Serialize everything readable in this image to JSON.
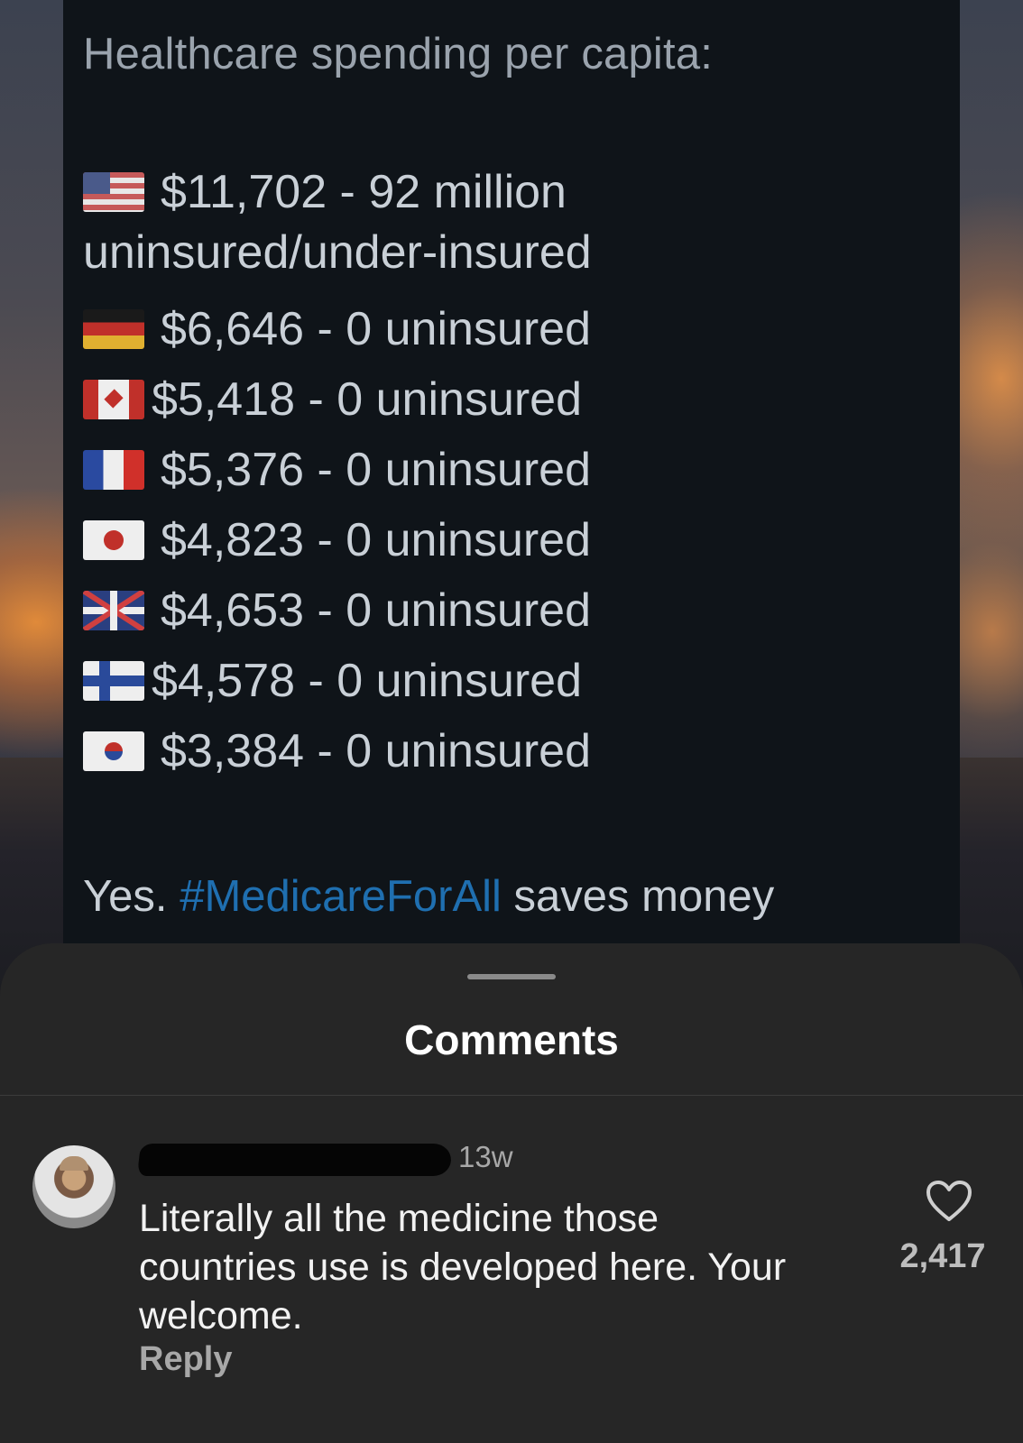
{
  "tweet": {
    "title": "Healthcare spending per capita:",
    "rows": [
      {
        "flag": "us-flag-icon",
        "text": "$11,702 - 92 million",
        "continuation": "uninsured/under-insured"
      },
      {
        "flag": "germany-flag-icon",
        "text": "$6,646 - 0 uninsured"
      },
      {
        "flag": "canada-flag-icon",
        "text": "$5,418 - 0 uninsured"
      },
      {
        "flag": "france-flag-icon",
        "text": "$5,376 - 0 uninsured"
      },
      {
        "flag": "japan-flag-icon",
        "text": "$4,823 - 0 uninsured"
      },
      {
        "flag": "uk-flag-icon",
        "text": "$4,653 - 0 uninsured"
      },
      {
        "flag": "finland-flag-icon",
        "text": "$4,578 - 0 uninsured"
      },
      {
        "flag": "south-korea-flag-icon",
        "text": "$3,384 - 0 uninsured"
      }
    ],
    "footer_prefix": "Yes.",
    "hashtag": "#MedicareForAll",
    "footer_suffix": "saves money",
    "hashtag_color": "#1f6fb0"
  },
  "comments": {
    "title": "Comments",
    "items": [
      {
        "timestamp": "13w",
        "text": "Literally all the medicine those countries use is developed here. Your welcome.",
        "reply_label": "Reply",
        "like_icon": "heart-outline-icon",
        "likes": "2,417"
      }
    ]
  }
}
